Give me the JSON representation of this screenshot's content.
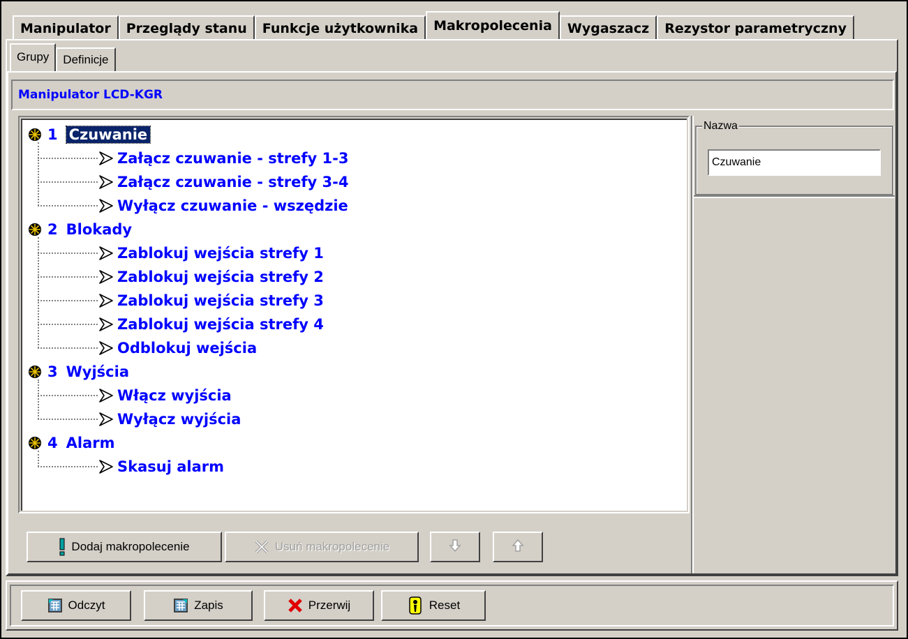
{
  "tabs": [
    "Manipulator",
    "Przeglądy stanu",
    "Funkcje użytkownika",
    "Makropolecenia",
    "Wygaszacz",
    "Rezystor parametryczny"
  ],
  "active_tab": "Makropolecenia",
  "sub_tabs": [
    "Grupy",
    "Definicje"
  ],
  "active_sub_tab": "Grupy",
  "header": {
    "title": "Manipulator LCD-KGR"
  },
  "tree": {
    "groups": [
      {
        "num": "1",
        "label": "Czuwanie",
        "selected": true,
        "items": [
          "Załącz czuwanie - strefy 1-3",
          "Załącz czuwanie - strefy 3-4",
          "Wyłącz czuwanie - wszędzie"
        ]
      },
      {
        "num": "2",
        "label": "Blokady",
        "items": [
          "Zablokuj wejścia strefy 1",
          "Zablokuj wejścia strefy 2",
          "Zablokuj wejścia strefy 3",
          "Zablokuj wejścia strefy 4",
          "Odblokuj wejścia"
        ]
      },
      {
        "num": "3",
        "label": "Wyjścia",
        "items": [
          "Włącz wyjścia",
          "Wyłącz wyjścia"
        ]
      },
      {
        "num": "4",
        "label": "Alarm",
        "items": [
          "Skasuj alarm"
        ]
      }
    ]
  },
  "buttons": {
    "add": "Dodaj makropolecenie",
    "remove": "Usuń makropolecenie",
    "down_icon": "arrow-down-icon",
    "up_icon": "arrow-up-icon"
  },
  "nazwa": {
    "label": "Nazwa",
    "value": "Czuwanie"
  },
  "bottom": {
    "read": "Odczyt",
    "write": "Zapis",
    "stop": "Przerwij",
    "reset": "Reset"
  },
  "colors": {
    "text_blue": "#0000ff",
    "selection": "#0a246a",
    "face": "#d4d0c8"
  }
}
